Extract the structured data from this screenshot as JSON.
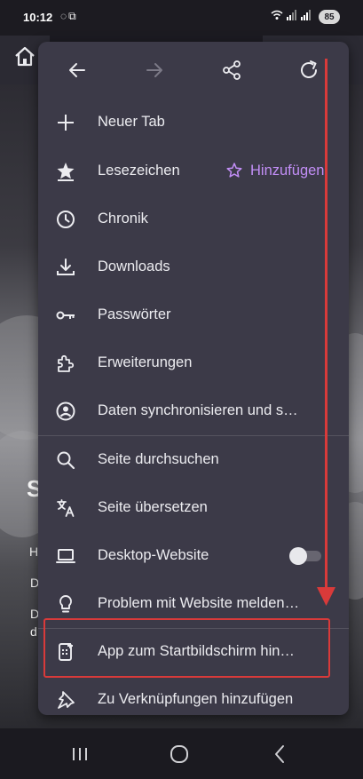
{
  "status_bar": {
    "time": "10:12",
    "left_icons": [
      "whatsapp-icon",
      "screen-record-icon"
    ],
    "right_icons": [
      "wifi-icon",
      "signal-icon",
      "signal-icon"
    ],
    "battery": "85"
  },
  "menu": {
    "items": [
      {
        "label": "Neuer Tab",
        "icon": "plus-icon"
      },
      {
        "label": "Lesezeichen",
        "icon": "bookmark-star-icon"
      },
      {
        "label": "Chronik",
        "icon": "clock-icon"
      },
      {
        "label": "Downloads",
        "icon": "download-icon"
      },
      {
        "label": "Passwörter",
        "icon": "key-icon"
      },
      {
        "label": "Erweiterungen",
        "icon": "puzzle-icon"
      },
      {
        "label": "Daten synchronisieren und s…",
        "icon": "account-icon"
      },
      {
        "label": "Seite durchsuchen",
        "icon": "search-icon"
      },
      {
        "label": "Seite übersetzen",
        "icon": "translate-icon"
      },
      {
        "label": "Desktop-Website",
        "icon": "laptop-icon"
      },
      {
        "label": "Problem mit Website melden…",
        "icon": "lightbulb-icon"
      },
      {
        "label": "App zum Startbildschirm hin…",
        "icon": "add-to-homescreen-icon"
      },
      {
        "label": "Zu Verknüpfungen hinzufügen",
        "icon": "pin-icon"
      }
    ],
    "bookmark_add_label": "Hinzufügen",
    "desktop_site_enabled": false,
    "accent_color": "#c28ef6"
  },
  "page_background": {
    "letters": [
      "S",
      "H",
      "D",
      "D",
      "d"
    ]
  },
  "annotation": {
    "highlight_color": "#d93a3a"
  }
}
